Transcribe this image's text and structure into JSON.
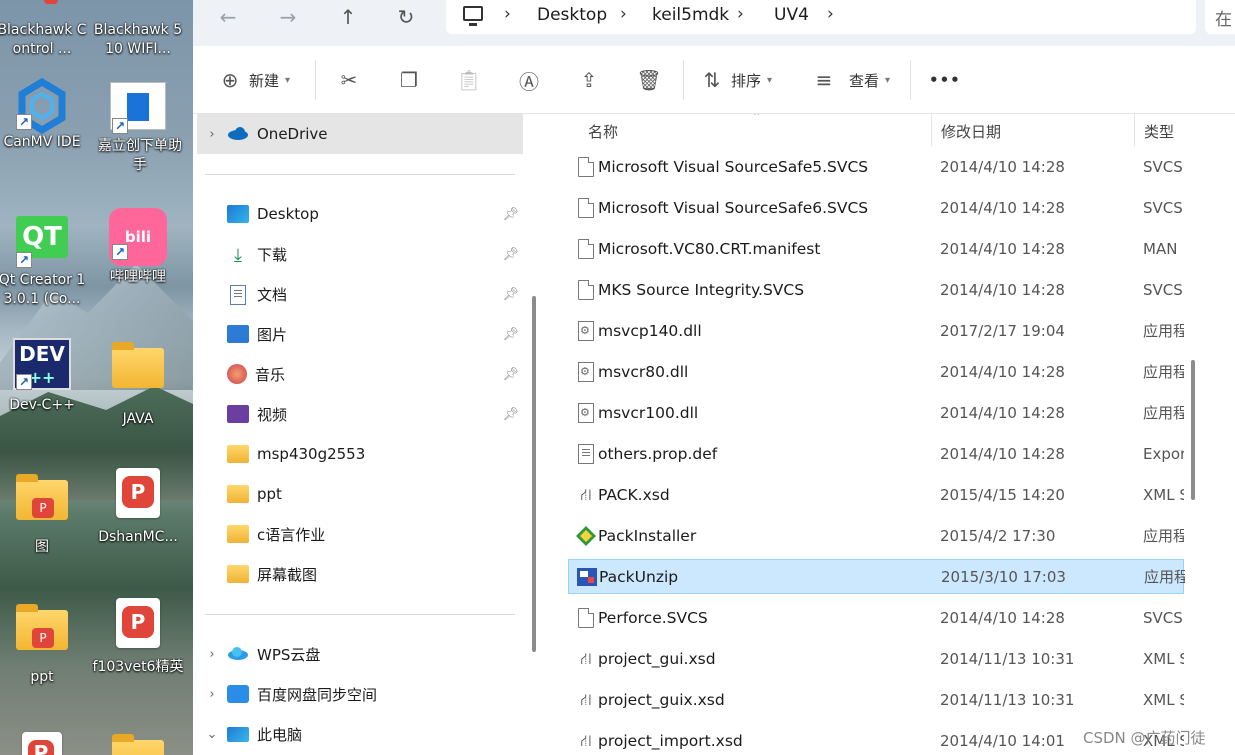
{
  "desktop": {
    "icons": [
      {
        "label": "Blackhawk Control ..."
      },
      {
        "label": "Blackhawk 510 WIFI..."
      },
      {
        "label": "CanMV IDE"
      },
      {
        "label": "嘉立创下单助手"
      },
      {
        "label": "Qt Creator 13.0.1 (Co..."
      },
      {
        "label": "哔哩哔哩"
      },
      {
        "label": "Dev-C++"
      },
      {
        "label": "JAVA"
      },
      {
        "label": "图"
      },
      {
        "label": "DshanMC..."
      },
      {
        "label": "ppt"
      },
      {
        "label": "f103vet6精英"
      }
    ]
  },
  "address": {
    "crumbs": [
      "Desktop",
      "keil5mdk",
      "UV4"
    ],
    "search_fragment": "在"
  },
  "toolbar": {
    "new_label": "新建",
    "sort_label": "排序",
    "view_label": "查看",
    "more_label": "•••"
  },
  "navpane": {
    "items": [
      {
        "label": "OneDrive"
      },
      {
        "label": "Desktop"
      },
      {
        "label": "下载"
      },
      {
        "label": "文档"
      },
      {
        "label": "图片"
      },
      {
        "label": "音乐"
      },
      {
        "label": "视频"
      },
      {
        "label": "msp430g2553"
      },
      {
        "label": "ppt"
      },
      {
        "label": "c语言作业"
      },
      {
        "label": "屏幕截图"
      },
      {
        "label": "WPS云盘"
      },
      {
        "label": "百度网盘同步空间"
      },
      {
        "label": "此电脑"
      }
    ]
  },
  "filelist": {
    "headers": {
      "name": "名称",
      "date": "修改日期",
      "type": "类型"
    },
    "rows": [
      {
        "name": "Microsoft Visual SourceSafe5.SVCS",
        "date": "2014/4/10 14:28",
        "type": "SVCS",
        "icon": "doc"
      },
      {
        "name": "Microsoft Visual SourceSafe6.SVCS",
        "date": "2014/4/10 14:28",
        "type": "SVCS",
        "icon": "doc"
      },
      {
        "name": "Microsoft.VC80.CRT.manifest",
        "date": "2014/4/10 14:28",
        "type": "MAN",
        "icon": "doc"
      },
      {
        "name": "MKS Source Integrity.SVCS",
        "date": "2014/4/10 14:28",
        "type": "SVCS",
        "icon": "doc"
      },
      {
        "name": "msvcp140.dll",
        "date": "2017/2/17 19:04",
        "type": "应用程",
        "icon": "dll"
      },
      {
        "name": "msvcr80.dll",
        "date": "2014/4/10 14:28",
        "type": "应用程",
        "icon": "dll"
      },
      {
        "name": "msvcr100.dll",
        "date": "2014/4/10 14:28",
        "type": "应用程",
        "icon": "dll"
      },
      {
        "name": "others.prop.def",
        "date": "2014/4/10 14:28",
        "type": "Expor",
        "icon": "txt"
      },
      {
        "name": "PACK.xsd",
        "date": "2015/4/15 14:20",
        "type": "XML S",
        "icon": "xsd"
      },
      {
        "name": "PackInstaller",
        "date": "2015/4/2 17:30",
        "type": "应用程",
        "icon": "packinstaller"
      },
      {
        "name": "PackUnzip",
        "date": "2015/3/10 17:03",
        "type": "应用程",
        "icon": "packunzip"
      },
      {
        "name": "Perforce.SVCS",
        "date": "2014/4/10 14:28",
        "type": "SVCS",
        "icon": "doc"
      },
      {
        "name": "project_gui.xsd",
        "date": "2014/11/13 10:31",
        "type": "XML S",
        "icon": "xsd"
      },
      {
        "name": "project_guix.xsd",
        "date": "2014/11/13 10:31",
        "type": "XML S",
        "icon": "xsd"
      },
      {
        "name": "project_import.xsd",
        "date": "2014/4/10 14:01",
        "type": "XML S",
        "icon": "xsd"
      }
    ]
  },
  "watermark": "CSDN @广药门徒"
}
